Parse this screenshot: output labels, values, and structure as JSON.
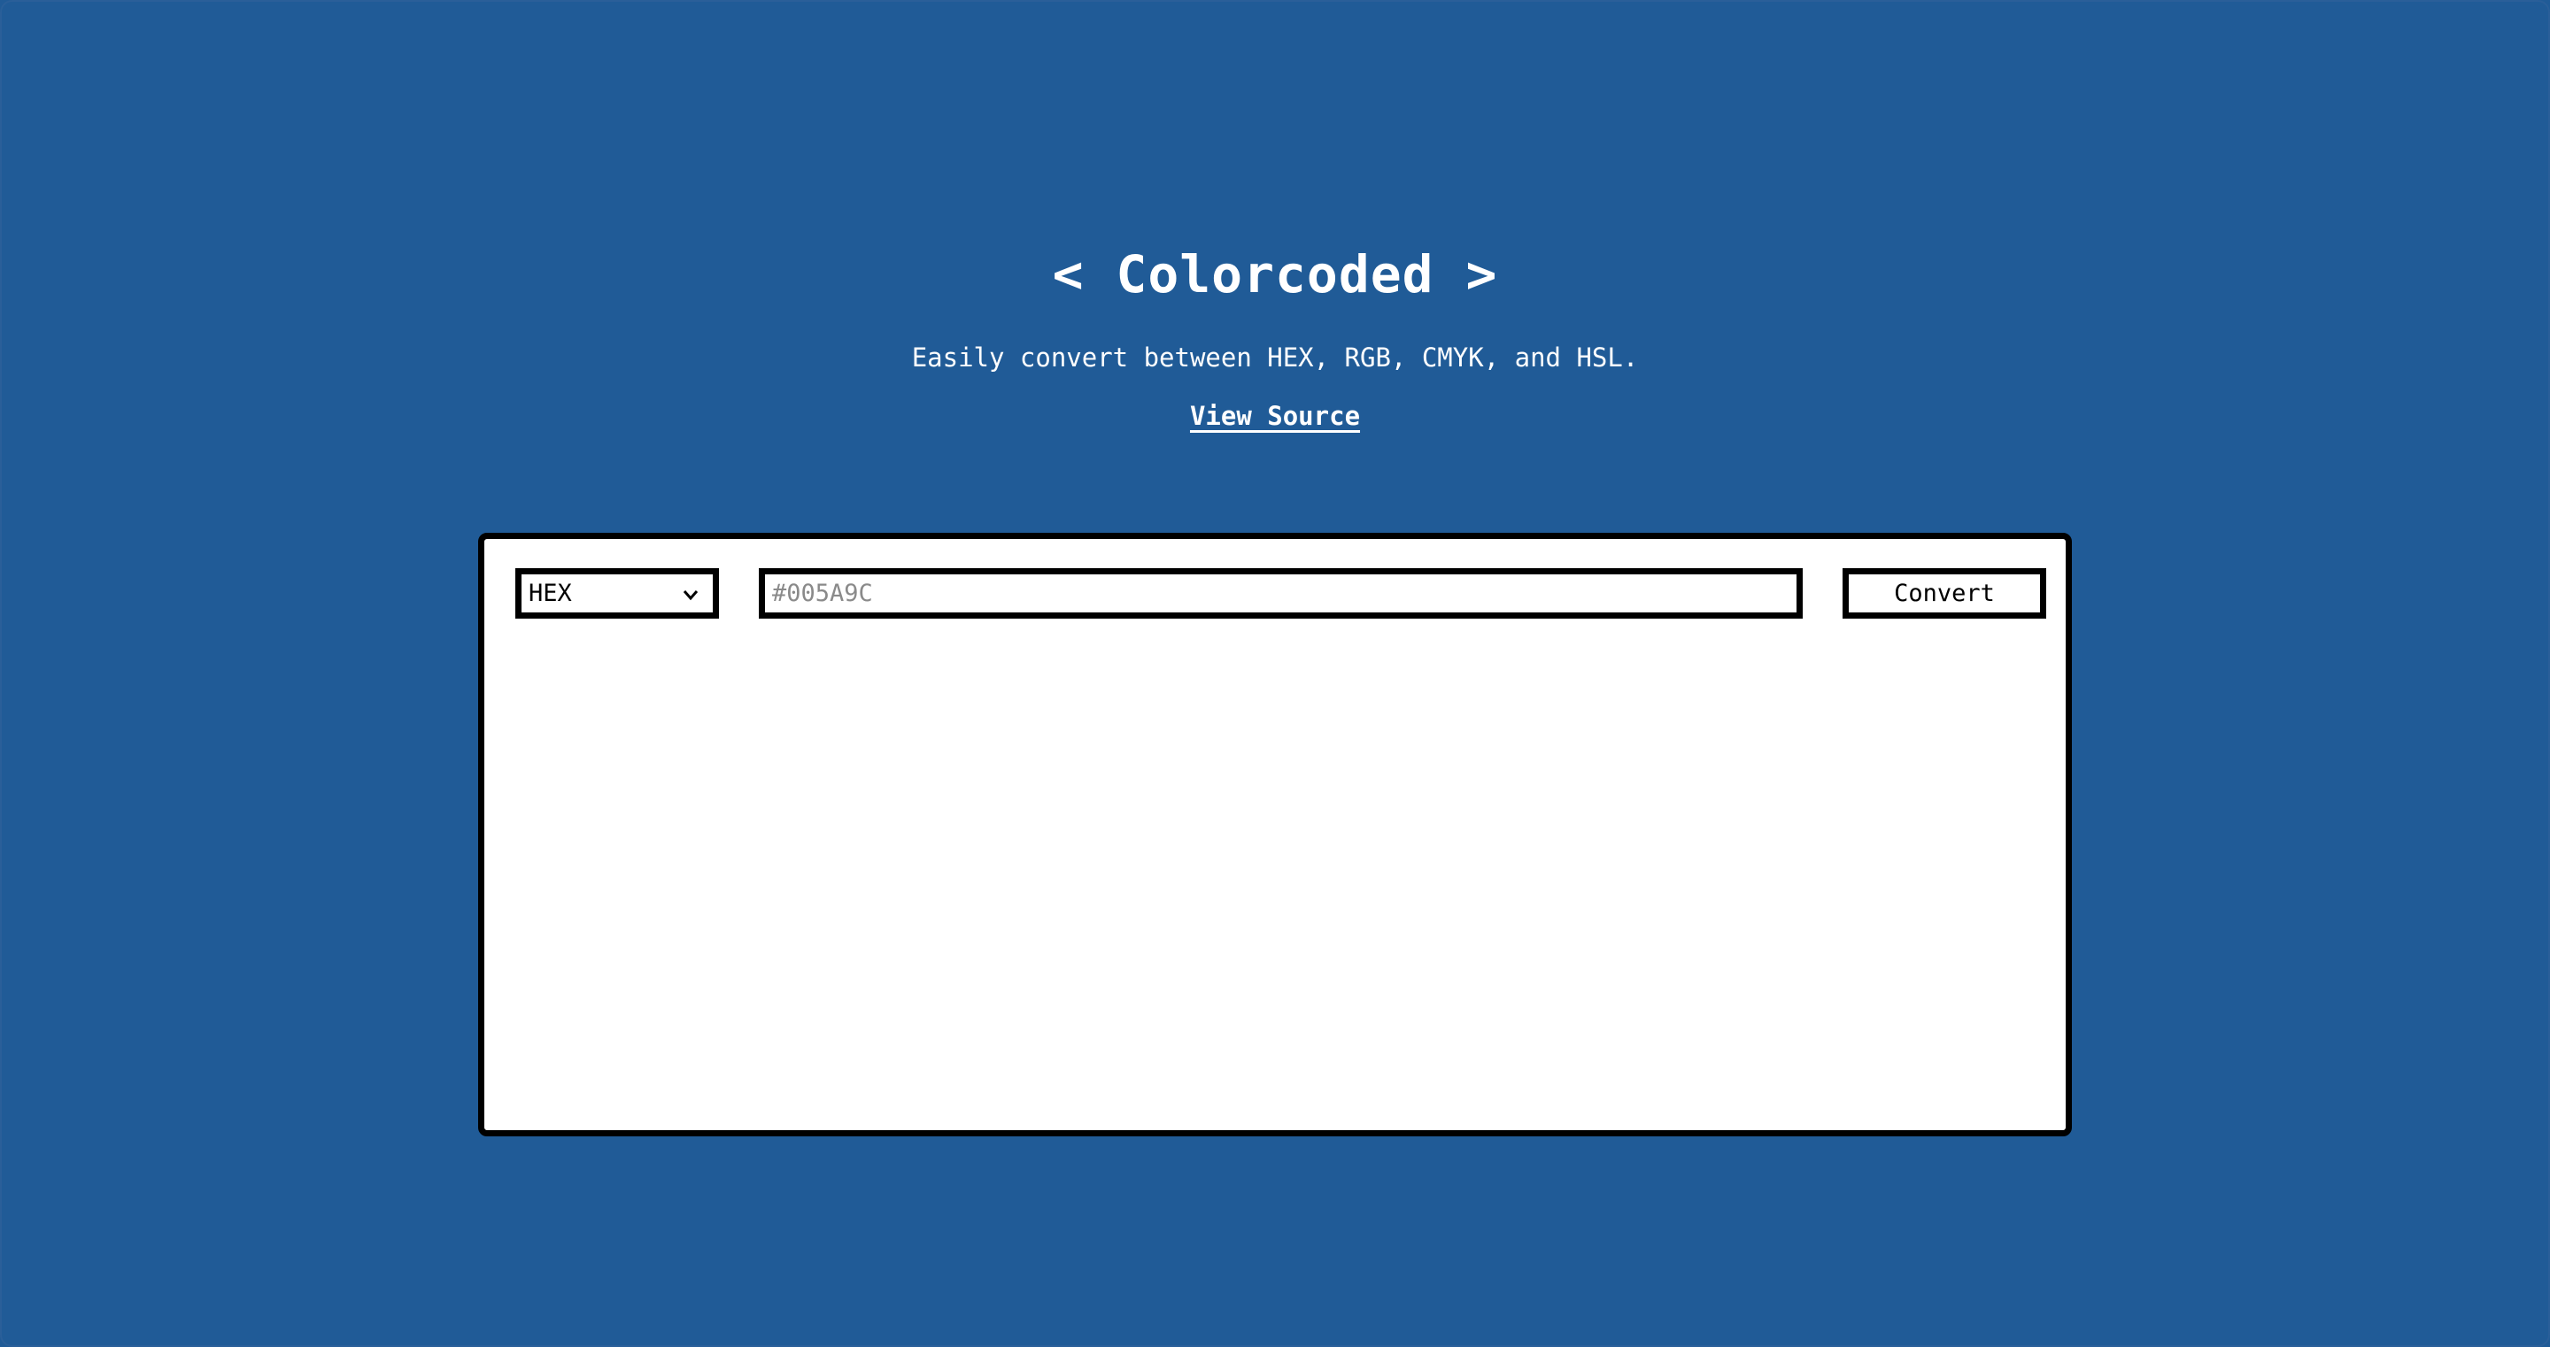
{
  "header": {
    "title": "< Colorcoded >",
    "subtitle": "Easily convert between HEX, RGB, CMYK, and HSL.",
    "source_link": "View Source"
  },
  "converter": {
    "format_select": {
      "selected": "HEX",
      "icon": "chevron-down-icon"
    },
    "color_input": {
      "value": "",
      "placeholder": "#005A9C"
    },
    "convert_label": "Convert"
  },
  "colors": {
    "background": "#205b97",
    "panel": "#ffffff",
    "border": "#000000",
    "text": "#ffffff"
  }
}
